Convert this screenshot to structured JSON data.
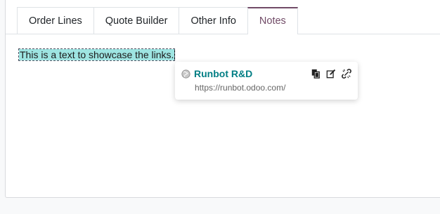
{
  "tabs": [
    {
      "label": "Order Lines",
      "active": false
    },
    {
      "label": "Quote Builder",
      "active": false
    },
    {
      "label": "Other Info",
      "active": false
    },
    {
      "label": "Notes",
      "active": true
    }
  ],
  "note": {
    "link_text": "This is a text to showcase the links."
  },
  "link_popover": {
    "title": "Runbot R&D",
    "url": "https://runbot.odoo.com/",
    "icons": [
      "globe-icon",
      "copy-icon",
      "edit-icon",
      "unlink-icon"
    ]
  },
  "colors": {
    "accent": "#714b67",
    "link": "#017e84",
    "selection": "#9ee5e2"
  }
}
